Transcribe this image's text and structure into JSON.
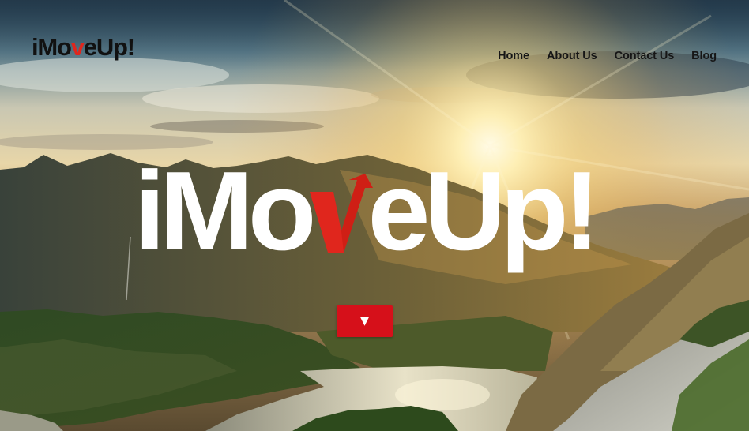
{
  "header": {
    "logo": {
      "prefix": "iMo",
      "accent": "v",
      "suffix": "eUp!"
    },
    "nav": [
      {
        "label": "Home"
      },
      {
        "label": "About Us"
      },
      {
        "label": "Contact Us"
      },
      {
        "label": "Blog"
      }
    ]
  },
  "hero": {
    "title": {
      "prefix": "iMo",
      "accent": "v",
      "suffix": "eUp!"
    },
    "scroll_icon": "▼"
  },
  "colors": {
    "accent": "#e0261d",
    "button": "#d6101a",
    "nav_text": "#161616",
    "title_text": "#ffffff"
  }
}
